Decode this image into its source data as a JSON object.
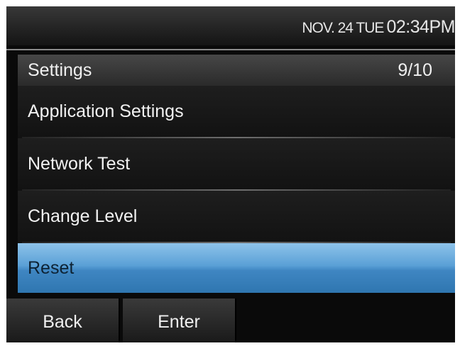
{
  "status_bar": {
    "date": "NOV. 24 TUE",
    "time": "02:34PM"
  },
  "settings_panel": {
    "title": "Settings",
    "page_indicator": "9/10",
    "items": [
      {
        "label": "Application Settings",
        "selected": false
      },
      {
        "label": "Network Test",
        "selected": false
      },
      {
        "label": "Change Level",
        "selected": false
      },
      {
        "label": "Reset",
        "selected": true
      }
    ]
  },
  "softkeys": {
    "back_label": "Back",
    "enter_label": "Enter"
  },
  "colors": {
    "selection_highlight": "#4a90c8",
    "background": "#0a0a0a"
  }
}
